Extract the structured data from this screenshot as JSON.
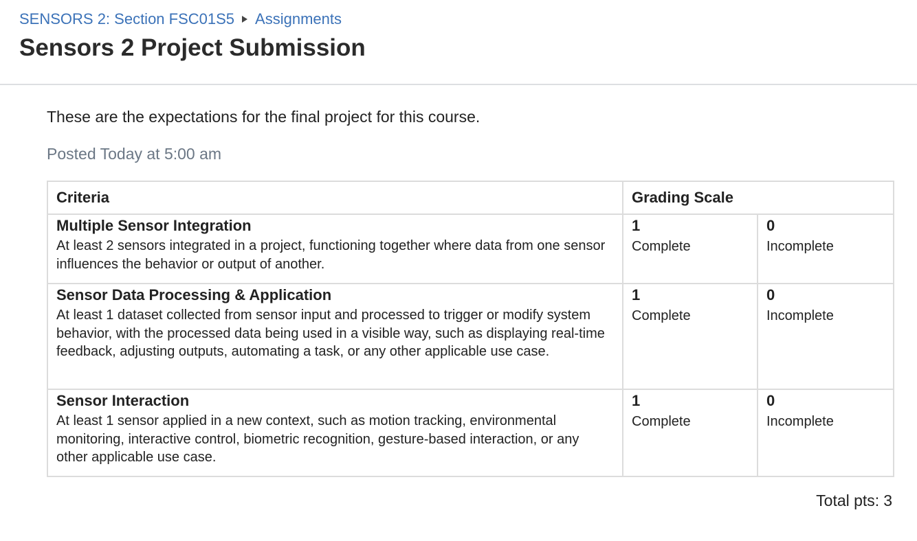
{
  "breadcrumb": {
    "course": "SENSORS 2: Section FSC01S5",
    "section": "Assignments"
  },
  "page": {
    "title": "Sensors 2 Project Submission",
    "description": "These are the expectations for the final project for this course.",
    "posted_label": "Posted",
    "posted_time": "Today at 5:00 am"
  },
  "rubric": {
    "headers": {
      "criteria": "Criteria",
      "grading_scale": "Grading Scale"
    },
    "rows": [
      {
        "title": "Multiple Sensor Integration",
        "description": "At least 2 sensors integrated in a project, functioning together where data from one sensor influences the behavior or output of another.",
        "ratings": [
          {
            "points": "1",
            "label": "Complete"
          },
          {
            "points": "0",
            "label": "Incomplete"
          }
        ]
      },
      {
        "title": "Sensor Data Processing & Application",
        "description": "At least 1 dataset collected from sensor input and processed to trigger or modify system behavior, with the processed data being used in a visible way, such as displaying real-time feedback, adjusting outputs, automating a task, or any other applicable use case.",
        "ratings": [
          {
            "points": "1",
            "label": "Complete"
          },
          {
            "points": "0",
            "label": "Incomplete"
          }
        ]
      },
      {
        "title": "Sensor Interaction",
        "description": "At least 1 sensor applied in a new context, such as motion tracking, environmental monitoring, interactive control, biometric recognition, gesture-based interaction, or any other applicable use case.",
        "ratings": [
          {
            "points": "1",
            "label": "Complete"
          },
          {
            "points": "0",
            "label": "Incomplete"
          }
        ]
      }
    ],
    "total_label": "Total pts:",
    "total_value": "3"
  },
  "colors": {
    "link": "#3b72b8",
    "muted": "#6b7785",
    "border": "#dcdcdc"
  }
}
